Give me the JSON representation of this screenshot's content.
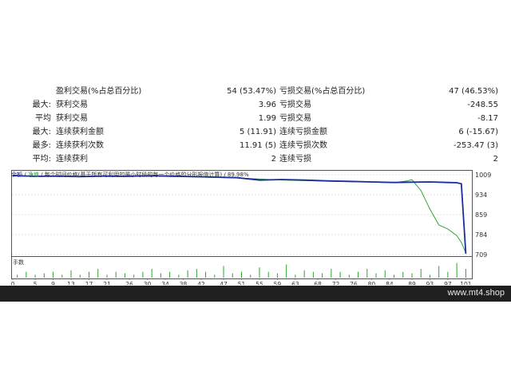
{
  "stats": [
    {
      "label_a": "",
      "label_b": "盈利交易(%占总百分比)",
      "value_1": "54 (53.47%)",
      "label_2": "亏损交易(%占总百分比)",
      "value_2": "47 (46.53%)"
    },
    {
      "label_a": "最大:",
      "label_b": "获利交易",
      "value_1": "3.96",
      "label_2": "亏损交易",
      "value_2": "-248.55"
    },
    {
      "label_a": "平均",
      "label_b": "获利交易",
      "value_1": "1.99",
      "label_2": "亏损交易",
      "value_2": "-8.17"
    },
    {
      "label_a": "最大:",
      "label_b": "连续获利金额",
      "value_1": "5 (11.91)",
      "label_2": "连续亏损金额",
      "value_2": "6 (-15.67)"
    },
    {
      "label_a": "最多:",
      "label_b": "连续获利次数",
      "value_1": "11.91 (5)",
      "label_2": "连续亏损次数",
      "value_2": "-253.47 (3)"
    },
    {
      "label_a": "平均:",
      "label_b": "连续获利",
      "value_1": "2",
      "label_2": "连续亏损",
      "value_2": "2"
    }
  ],
  "legend": {
    "balance": "余额",
    "equity": "净值",
    "rest": " / 每个时间价格(基于所有可利用的最小时段的每一个价格的分形报值计算) / 89.98%"
  },
  "sub_chart_label": "手数",
  "footer": {
    "watermark": "www.mt4.shop"
  },
  "colors": {
    "balance": "#1a2e9a",
    "equity": "#1c9e1c",
    "volume": "#2aa52a",
    "grid": "#c8c8c8",
    "footer_bg": "#1f1f1f"
  },
  "chart_data": {
    "type": "line",
    "y_ticks": [
      1009,
      934,
      859,
      784,
      709
    ],
    "ylim": [
      709,
      1009
    ],
    "x_ticks": [
      0,
      5,
      9,
      13,
      17,
      21,
      26,
      30,
      34,
      38,
      42,
      47,
      51,
      55,
      59,
      63,
      68,
      72,
      76,
      80,
      84,
      89,
      93,
      97,
      101
    ],
    "xlim": [
      0,
      102
    ],
    "series": [
      {
        "name": "余额",
        "x": [
          0,
          5,
          10,
          15,
          20,
          25,
          30,
          35,
          40,
          45,
          50,
          55,
          60,
          65,
          70,
          75,
          80,
          85,
          89,
          93,
          97,
          99,
          100,
          101
        ],
        "values": [
          1006,
          1003,
          1004,
          1002,
          1004,
          1003,
          1005,
          1004,
          1002,
          1000,
          998,
          989,
          991,
          989,
          986,
          984,
          982,
          980,
          981,
          982,
          980,
          979,
          975,
          712
        ]
      },
      {
        "name": "净值",
        "x": [
          0,
          10,
          20,
          30,
          40,
          50,
          60,
          70,
          80,
          85,
          88,
          89,
          91,
          93,
          95,
          97,
          99,
          100,
          101
        ],
        "values": [
          1005,
          1003,
          1003,
          1004,
          1001,
          997,
          989,
          985,
          981,
          979,
          986,
          990,
          950,
          880,
          820,
          805,
          780,
          755,
          715
        ]
      }
    ],
    "volume": {
      "x": [
        1,
        3,
        5,
        7,
        9,
        11,
        13,
        15,
        17,
        19,
        21,
        23,
        25,
        27,
        29,
        31,
        33,
        35,
        37,
        39,
        41,
        43,
        45,
        47,
        49,
        51,
        53,
        55,
        57,
        59,
        61,
        63,
        65,
        67,
        69,
        71,
        73,
        75,
        77,
        79,
        81,
        83,
        85,
        87,
        89,
        91,
        93,
        95,
        97,
        99,
        101
      ],
      "values": [
        0.1,
        0.2,
        0.1,
        0.15,
        0.2,
        0.1,
        0.25,
        0.1,
        0.2,
        0.3,
        0.1,
        0.2,
        0.15,
        0.1,
        0.2,
        0.3,
        0.15,
        0.2,
        0.1,
        0.25,
        0.3,
        0.2,
        0.1,
        0.4,
        0.15,
        0.2,
        0.1,
        0.35,
        0.2,
        0.15,
        0.45,
        0.1,
        0.25,
        0.2,
        0.15,
        0.3,
        0.2,
        0.1,
        0.2,
        0.3,
        0.15,
        0.25,
        0.1,
        0.2,
        0.15,
        0.3,
        0.1,
        0.4,
        0.2,
        0.5,
        0.3
      ]
    }
  }
}
